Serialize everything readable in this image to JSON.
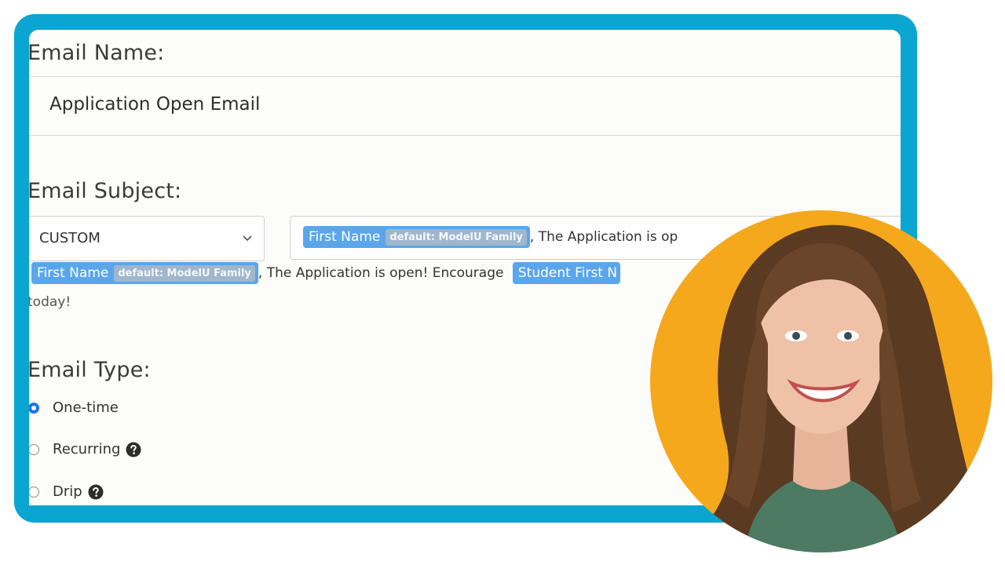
{
  "form": {
    "email_name_label": "Email Name:",
    "email_name_value": "Application Open Email",
    "email_subject_label": "Email Subject:",
    "subject_select_value": "CUSTOM",
    "subject_input": {
      "chip_label": "First Name",
      "chip_default": "default: ModelU Family",
      "text": ", The Application is op"
    },
    "preview": {
      "chip1_label": "First Name",
      "chip1_default": "default: ModelU Family",
      "middle_text": ", The Application is open! Encourage",
      "chip2_label": "Student First N",
      "end_text": "today!"
    },
    "email_type_label": "Email Type:",
    "email_types": [
      {
        "label": "One-time",
        "selected": true
      },
      {
        "label": "Recurring",
        "selected": false,
        "help_icon": "question-circle-icon"
      },
      {
        "label": "Drip",
        "selected": false,
        "help_icon": "question-circle-icon"
      }
    ]
  },
  "colors": {
    "frame": "#0aa6d1",
    "chip": "#5aa6ec",
    "avatar_background": "#f5a81c",
    "radio_selected": "#1a73e8"
  }
}
